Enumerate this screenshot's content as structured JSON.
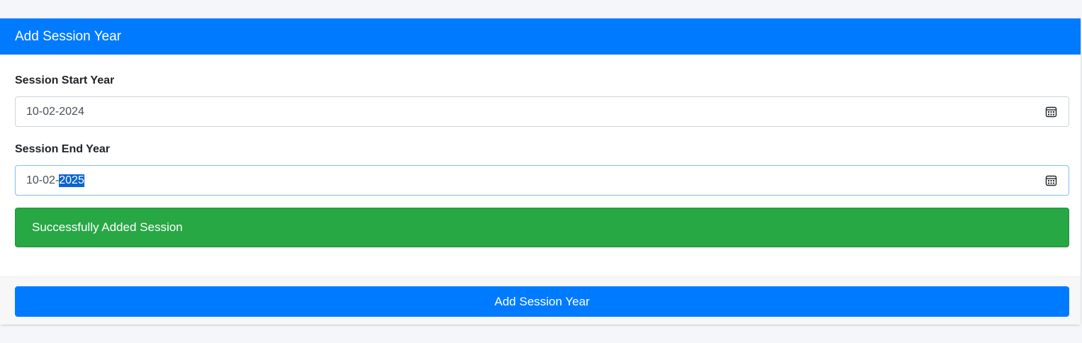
{
  "card": {
    "title": "Add Session Year"
  },
  "form": {
    "start_label": "Session Start Year",
    "start_value": "10-02-2024",
    "end_label": "Session End Year",
    "end_value_prefix": "10-02-",
    "end_value_selected": "2025",
    "calendar_icon": "calendar-icon"
  },
  "alert": {
    "message": "Successfully Added Session"
  },
  "footer": {
    "submit_label": "Add Session Year"
  },
  "colors": {
    "primary": "#007bff",
    "success": "#28a745",
    "background": "#f4f6f9"
  }
}
